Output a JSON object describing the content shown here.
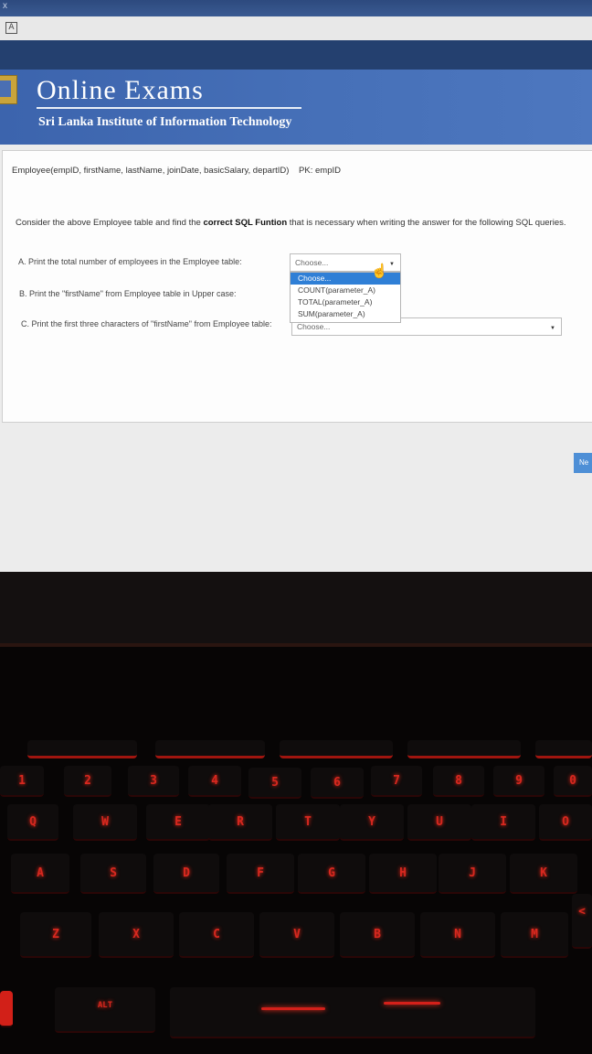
{
  "browser": {
    "tab_close_glyph": "x",
    "page_icon_glyph": "A"
  },
  "header": {
    "title": "Online Exams",
    "subtitle": "Sri Lanka Institute of Information Technology"
  },
  "question": {
    "schema": "Employee(empID, firstName, lastName, joinDate, basicSalary, departID)",
    "pk": "PK: empID",
    "intro_before": "Consider the above Employee table and find the ",
    "intro_bold": "correct SQL Funtion",
    "intro_after": " that is necessary when writing the answer for the following SQL queries.",
    "items": [
      {
        "label": "A. Print the total number of employees in the Employee table:",
        "select_value": "Choose..."
      },
      {
        "label": "B. Print the \"firstName\" from Employee table in Upper case:"
      },
      {
        "label": "C. Print the first three characters of \"firstName\" from Employee table:",
        "select_value": "Choose..."
      }
    ],
    "dropdown_options": [
      "Choose...",
      "COUNT(parameter_A)",
      "TOTAL(parameter_A)",
      "SUM(parameter_A)"
    ],
    "selected_option": "Choose..."
  },
  "next_label": "Ne",
  "keyboard": {
    "number_row": [
      "1",
      "2",
      "3",
      "4",
      "5",
      "6",
      "7",
      "8",
      "9",
      "0"
    ],
    "row_q": [
      "Q",
      "W",
      "E",
      "R",
      "T",
      "Y",
      "U",
      "I",
      "O"
    ],
    "row_a": [
      "A",
      "S",
      "D",
      "F",
      "G",
      "H",
      "J",
      "K"
    ],
    "row_z": [
      "Z",
      "X",
      "C",
      "V",
      "B",
      "N",
      "M",
      "<"
    ],
    "alt_label": "ALT"
  },
  "colors": {
    "header_blue": "#4670b8",
    "option_highlight": "#2f7fd6",
    "key_backlight": "#d7281f"
  }
}
